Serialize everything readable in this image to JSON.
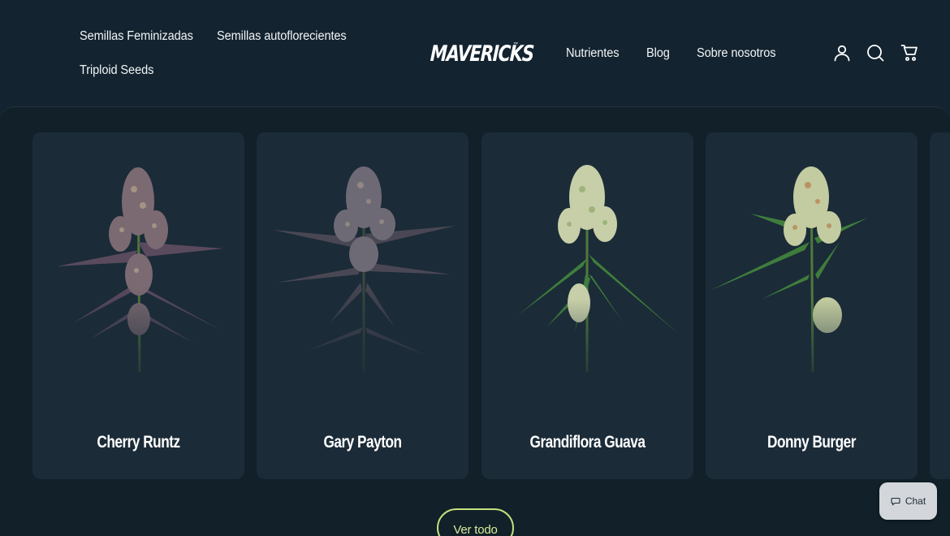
{
  "header": {
    "nav_left": [
      {
        "label": "Semillas Feminizadas"
      },
      {
        "label": "Semillas autoflorecientes"
      },
      {
        "label": "Triploid Seeds"
      }
    ],
    "logo": {
      "text": "MAVERICKS",
      "tm": "™"
    },
    "nav_right": [
      {
        "label": "Nutrientes"
      },
      {
        "label": "Blog"
      },
      {
        "label": "Sobre nosotros"
      }
    ],
    "icons": [
      "account-icon",
      "search-icon",
      "cart-icon"
    ]
  },
  "products": [
    {
      "name": "Cherry Runtz",
      "tone": "purple"
    },
    {
      "name": "Gary Payton",
      "tone": "dark-purple"
    },
    {
      "name": "Grandiflora Guava",
      "tone": "green"
    },
    {
      "name": "Donny Burger",
      "tone": "green-light"
    }
  ],
  "actions": {
    "ver_todo": "Ver todo",
    "chat": "Chat"
  },
  "colors": {
    "background": "#13232f",
    "card": "#1b2b38",
    "accent": "#c6e07f",
    "chat_bg": "#d3d7db"
  }
}
